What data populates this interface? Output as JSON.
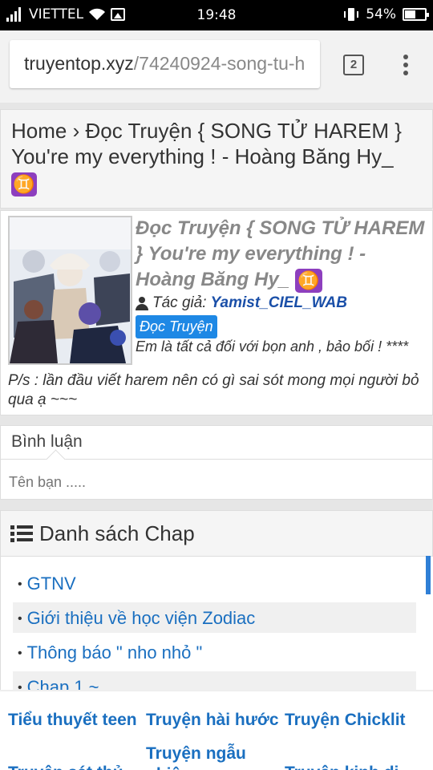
{
  "status_bar": {
    "carrier": "VIETTEL",
    "time": "19:48",
    "battery": "54%",
    "battery_level": 0.54
  },
  "browser": {
    "url_host": "truyentop.xyz",
    "url_path": "/74240924-song-tu-h",
    "tab_count": "2"
  },
  "breadcrumb": {
    "text": "Home › Đọc Truyện { SONG TỬ HAREM } You're my everything ! - Hoàng Băng Hy_",
    "emoji": "♊"
  },
  "story": {
    "title": "Đọc Truyện { SONG TỬ HAREM } You're my everything ! - Hoàng Băng Hy_",
    "title_emoji": "♊",
    "author_label": "Tác giả:",
    "author": "Yamist_CIEL_WAB",
    "read_button": "Đọc Truyện",
    "description_1": "Em là tất cả đối với bọn anh , bảo bối ! ****",
    "description_2": "P/s : lần đầu viết harem nên có gì sai sót mong mọi người bỏ qua ạ ~~~"
  },
  "comments": {
    "heading": "Bình luận",
    "name_placeholder": "Tên bạn ....."
  },
  "chapters": {
    "heading": "Danh sách Chap",
    "items": [
      "GTNV",
      "Giới thiệu về học viện Zodiac",
      "Thông báo \" nho nhỏ \"",
      "Chap 1 ~"
    ]
  },
  "bottom_nav": {
    "links": [
      "Tiểu thuyết teen",
      "Truyện hài hước",
      "Truyện Chicklit",
      "Truyện sát thủ",
      "Truyện ngẫu nhiên",
      "Truyện kinh dị"
    ]
  },
  "colors": {
    "link": "#1a6fc0",
    "accent_blue": "#1e88e5",
    "gemini_purple": "#8d3fbe"
  }
}
